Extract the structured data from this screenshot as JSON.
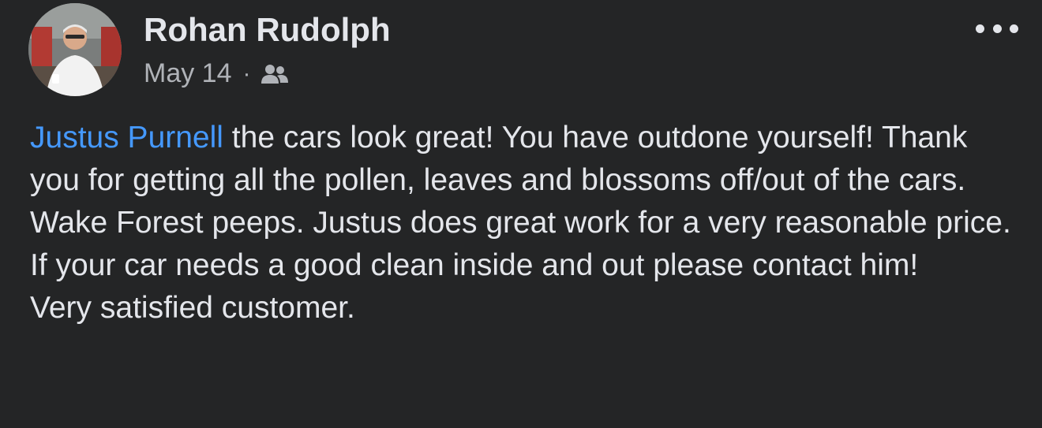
{
  "post": {
    "author": "Rohan Rudolph",
    "date": "May 14",
    "separator": "·",
    "audience_icon": "friends-icon",
    "more_icon": "more-horizontal-icon",
    "mention": "Justus Purnell",
    "line1_rest": " the cars look great! You have outdone yourself! Thank you for getting all the pollen, leaves and blossoms off/out of the cars.",
    "line2": "Wake Forest peeps. Justus does great work for a very reasonable price. If your car needs a good clean inside and out please contact him!",
    "line3": "Very satisfied customer."
  },
  "colors": {
    "background": "#242526",
    "primary_text": "#e4e6eb",
    "secondary_text": "#b0b3b8",
    "mention_link": "#4599ff"
  }
}
